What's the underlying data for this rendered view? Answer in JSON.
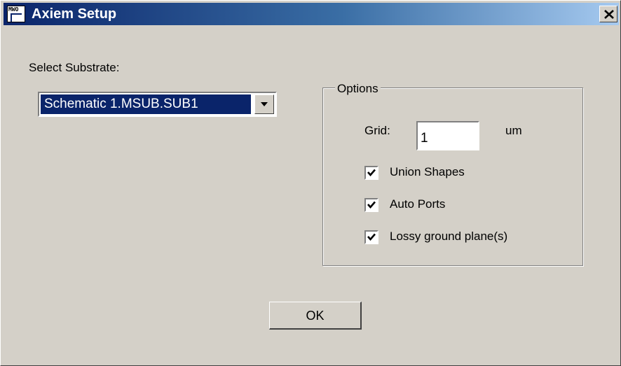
{
  "window": {
    "title": "Axiem Setup",
    "icon_text": "MWO",
    "icon": "app-icon",
    "close_icon": "close-icon"
  },
  "substrate": {
    "label": "Select Substrate:",
    "selected": "Schematic 1.MSUB.SUB1",
    "dropdown_icon": "chevron-down-icon"
  },
  "options": {
    "group_label": "Options",
    "grid_label": "Grid:",
    "grid_value": "1",
    "grid_unit": "um",
    "checkboxes": [
      {
        "label": "Union Shapes",
        "checked": true
      },
      {
        "label": "Auto Ports",
        "checked": true
      },
      {
        "label": "Lossy ground plane(s)",
        "checked": true
      }
    ]
  },
  "buttons": {
    "ok_label": "OK"
  },
  "colors": {
    "title_start": "#0a246a",
    "title_end": "#a6caf0",
    "face": "#d4d0c8",
    "selection": "#0a246a"
  }
}
